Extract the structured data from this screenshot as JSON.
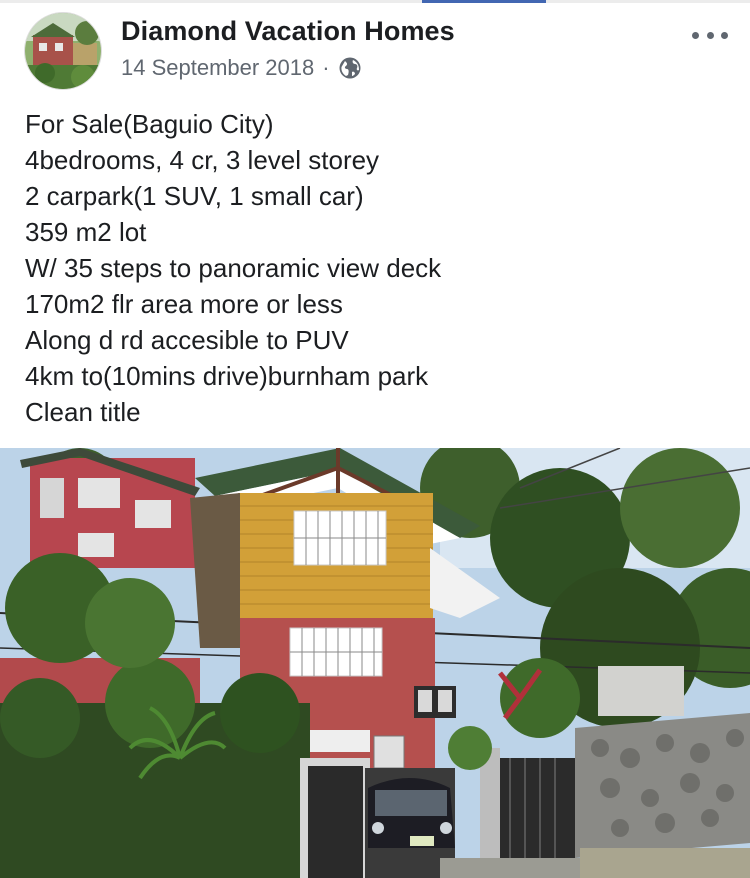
{
  "post": {
    "author": "Diamond Vacation Homes",
    "date": "14 September 2018",
    "separator": "·",
    "privacy_icon": "globe-icon",
    "more_icon": "more-options-icon",
    "lines": [
      "For Sale(Baguio City)",
      "4bedrooms, 4 cr, 3 level storey",
      "2 carpark(1 SUV, 1 small car)",
      "359 m2 lot",
      "W/ 35 steps to panoramic view deck",
      "170m2 flr area more or less",
      "Along d rd accesible to PUV",
      "4km to(10mins drive)burnham park",
      "Clean title"
    ]
  },
  "colors": {
    "accent": "#4267b2",
    "text_primary": "#1c1e21",
    "text_secondary": "#606770"
  }
}
